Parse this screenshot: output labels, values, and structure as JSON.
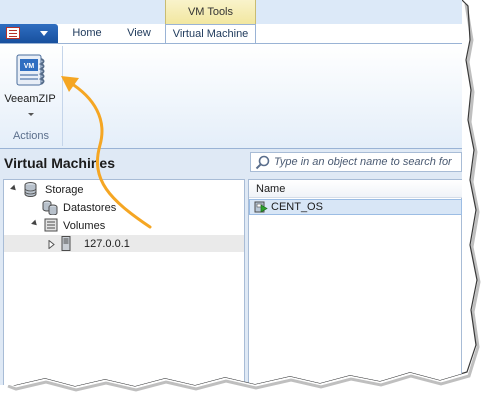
{
  "ribbon": {
    "context_group_label": "VM Tools",
    "tabs": [
      {
        "label": "Home",
        "active": false
      },
      {
        "label": "View",
        "active": false
      },
      {
        "label": "Virtual Machine",
        "active": true
      }
    ],
    "buttons": [
      {
        "label": "VeeamZIP",
        "icon": "veeamzip-icon",
        "has_dropdown": true
      }
    ],
    "group_label": "Actions"
  },
  "left_panel": {
    "title": "Virtual Machines",
    "tree": [
      {
        "label": "Storage",
        "icon": "database-icon",
        "expanded": true
      },
      {
        "label": "Datastores",
        "icon": "datastores-icon"
      },
      {
        "label": "Volumes",
        "icon": "volumes-icon",
        "expanded": true
      },
      {
        "label": "127.0.0.1",
        "icon": "server-icon",
        "expanded": false
      }
    ]
  },
  "right_panel": {
    "search_placeholder": "Type in an object name to search for",
    "columns": [
      "Name"
    ],
    "rows": [
      {
        "name": "CENT_OS",
        "icon": "vm-running-icon",
        "selected": true
      }
    ]
  },
  "colors": {
    "accent_arrow": "#f5a623",
    "ribbon_blue": "#1e5aaa",
    "context_tab_yellow": "#f2e7a0",
    "selection_blue": "#d8e6f6"
  }
}
